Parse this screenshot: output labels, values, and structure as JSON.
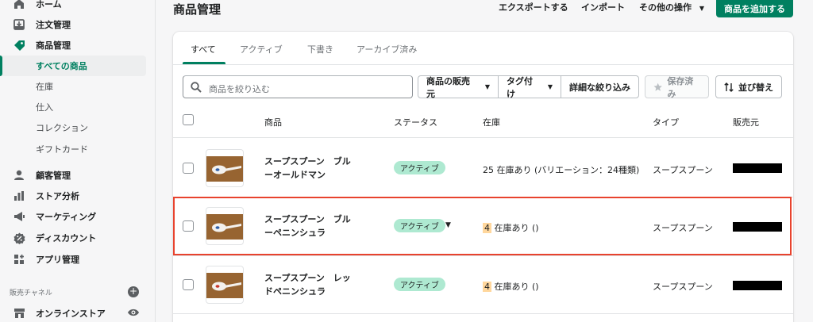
{
  "sidebar": {
    "items": [
      {
        "label": "ホーム",
        "icon": "home-icon"
      },
      {
        "label": "注文管理",
        "icon": "inbox-download-icon"
      },
      {
        "label": "商品管理",
        "icon": "tag-icon"
      },
      {
        "label": "すべての商品"
      },
      {
        "label": "在庫"
      },
      {
        "label": "仕入"
      },
      {
        "label": "コレクション"
      },
      {
        "label": "ギフトカード"
      },
      {
        "label": "顧客管理",
        "icon": "person-icon"
      },
      {
        "label": "ストア分析",
        "icon": "bar-chart-icon"
      },
      {
        "label": "マーケティング",
        "icon": "megaphone-icon"
      },
      {
        "label": "ディスカウント",
        "icon": "discount-icon"
      },
      {
        "label": "アプリ管理",
        "icon": "apps-icon"
      }
    ],
    "sales_channels_label": "販売チャネル",
    "online_store_label": "オンラインストア",
    "active_color": "#008060"
  },
  "header": {
    "title": "商品管理",
    "export_label": "エクスポートする",
    "import_label": "インポート",
    "more_actions_label": "その他の操作",
    "add_product_label": "商品を追加する"
  },
  "tabs": [
    {
      "label": "すべて"
    },
    {
      "label": "アクティブ"
    },
    {
      "label": "下書き"
    },
    {
      "label": "アーカイブ済み"
    }
  ],
  "filters": {
    "search_placeholder": "商品を絞り込む",
    "vendor_label": "商品の販売元",
    "tag_label": "タグ付け",
    "more_filters_label": "詳細な絞り込み",
    "saved_label": "保存済み",
    "sort_label": "並び替え"
  },
  "table": {
    "headers": {
      "product": "商品",
      "status": "ステータス",
      "inventory": "在庫",
      "type": "タイプ",
      "vendor": "販売元"
    },
    "rows": [
      {
        "name_line1": "スープスプーン　ブル",
        "name_line2": "ーオールドマン",
        "status": "アクティブ",
        "inventory_full": "25 在庫あり (バリエーション：24種類)",
        "type": "スープスプーン"
      },
      {
        "name_line1": "スープスプーン　ブル",
        "name_line2": "ーペニンシュラ",
        "status": "アクティブ",
        "inventory_num": "4",
        "inventory_text": " 在庫あり ()",
        "type": "スープスプーン"
      },
      {
        "name_line1": "スープスプーン　レッ",
        "name_line2": "ドペニンシュラ",
        "status": "アクティブ",
        "inventory_num": "4",
        "inventory_text": " 在庫あり ()",
        "type": "スープスプーン"
      }
    ]
  }
}
